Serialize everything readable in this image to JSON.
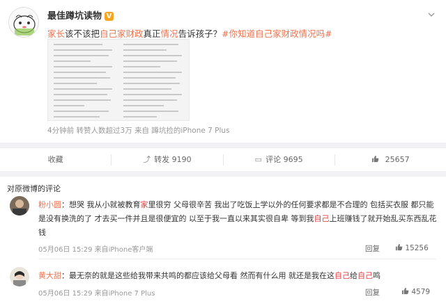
{
  "post": {
    "author": "最佳蹲坑读物",
    "verified_badge": "V",
    "text_parts": [
      {
        "t": "家长",
        "c": "link"
      },
      {
        "t": "该不该把",
        "c": ""
      },
      {
        "t": "自己家财政",
        "c": "link"
      },
      {
        "t": "真正",
        "c": ""
      },
      {
        "t": "情况",
        "c": "link"
      },
      {
        "t": "告诉孩子？",
        "c": ""
      },
      {
        "t": "#你知道自己家财政情况吗#",
        "c": "link"
      }
    ],
    "meta": "4分钟前  转赞人数超过3万  来自 蹲坑捡的iPhone 7 Plus",
    "menu_icon": "chevron-down-icon"
  },
  "actions": [
    {
      "label": "收藏",
      "icon": "",
      "name": "favorite-button"
    },
    {
      "label": "转发 9190",
      "icon": "⤴",
      "name": "repost-button"
    },
    {
      "label": "评论 9695",
      "icon": "▭",
      "name": "comment-button"
    },
    {
      "label": "25657",
      "icon": "👍",
      "name": "like-button"
    }
  ],
  "comments_header": "对原微博的评论",
  "comments": [
    {
      "name": "粉小圆",
      "parts": [
        {
          "t": "：想哭 我从小就被教育",
          "c": ""
        },
        {
          "t": "家",
          "c": "hl"
        },
        {
          "t": "里很穷 父母很辛苦 我出了吃饭上学以外的任何要求都是不合理的 包括买衣服 都只能是没有换洗的了 才去买一件并且是很便宜的 以至于我一直以来其实很自卑 等到我",
          "c": ""
        },
        {
          "t": "自己",
          "c": "hl"
        },
        {
          "t": "上班赚钱了就开始乱买东西乱花钱",
          "c": ""
        }
      ],
      "meta": "05月06日 15:29 来自iPhone客户端",
      "reply": "回复",
      "likes": "15256"
    },
    {
      "name": "黄大甜",
      "parts": [
        {
          "t": "：最无奈的就是这些给我带来共鸣的都应该给父母看 然而有什么用 就还是我在这",
          "c": ""
        },
        {
          "t": "自己",
          "c": "hl"
        },
        {
          "t": "给",
          "c": ""
        },
        {
          "t": "自己",
          "c": "hl"
        },
        {
          "t": "鸣",
          "c": ""
        }
      ],
      "meta": "05月06日 15:29 来自iPhone 7 Plus",
      "reply": "回复",
      "likes": "4579"
    }
  ]
}
